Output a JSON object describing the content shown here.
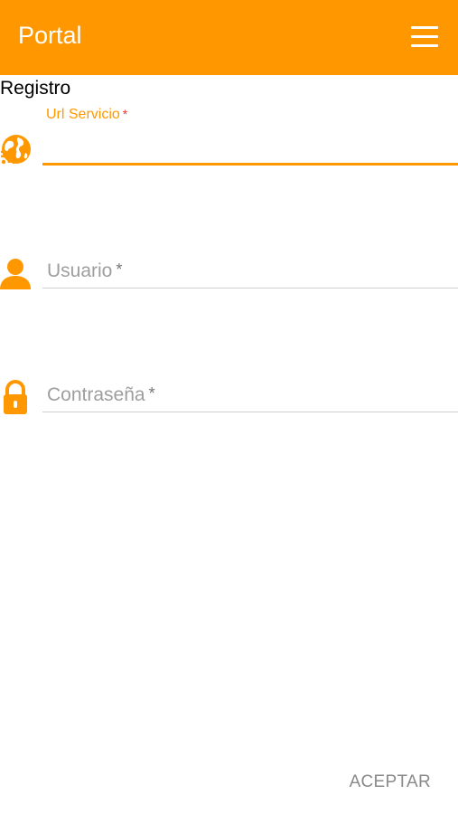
{
  "app_bar": {
    "title": "Portal",
    "menu_icon": "hamburger-menu-icon",
    "background_color": "#ff9800"
  },
  "form": {
    "section_title": "Registro",
    "fields": [
      {
        "icon": "globe-wifi-icon",
        "label": "Url Servicio",
        "required_mark": "*",
        "value": "",
        "state": "focused"
      },
      {
        "icon": "user-icon",
        "placeholder": "Usuario",
        "required_mark": "*",
        "value": "",
        "state": "idle"
      },
      {
        "icon": "lock-icon",
        "placeholder": "Contraseña",
        "required_mark": "*",
        "value": "",
        "state": "idle"
      }
    ]
  },
  "actions": {
    "accept_label": "ACEPTAR"
  },
  "colors": {
    "accent": "#ff9800",
    "required": "#e53935",
    "placeholder": "#9e9e9e"
  }
}
